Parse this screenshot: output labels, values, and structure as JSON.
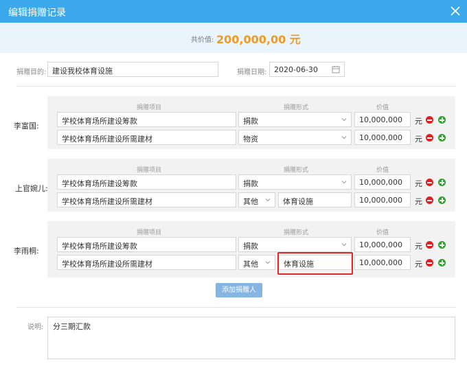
{
  "dialog": {
    "title": "编辑捐赠记录",
    "close_icon": "close-icon"
  },
  "summary": {
    "label": "共价值:",
    "value": "200,000,00 元"
  },
  "form": {
    "purpose_label": "捐赠目的:",
    "purpose_value": "建设我校体育设施",
    "date_label": "捐赠日期:",
    "date_value": "2020-06-30"
  },
  "columns": {
    "item": "捐赠项目",
    "form": "捐赠形式",
    "value": "价值"
  },
  "donors": [
    {
      "name": "李富国:",
      "rows": [
        {
          "item": "学校体育场所建设筹款",
          "form": "捐款",
          "extra": "",
          "value": "10,000,000",
          "unit": "元"
        },
        {
          "item": "学校体育场所建设所需建材",
          "form": "物资",
          "extra": "",
          "value": "10,000,000",
          "unit": "元"
        }
      ]
    },
    {
      "name": "上官婉儿:",
      "rows": [
        {
          "item": "学校体育场所建设筹款",
          "form": "捐款",
          "extra": "",
          "value": "10,000,000",
          "unit": "元"
        },
        {
          "item": "学校体育场所建设所需建材",
          "form": "其他",
          "extra": "体育设施",
          "value": "10,000,000",
          "unit": "元"
        }
      ]
    },
    {
      "name": "李雨桐:",
      "rows": [
        {
          "item": "学校体育场所建设筹款",
          "form": "捐款",
          "extra": "",
          "value": "10,000,000",
          "unit": "元"
        },
        {
          "item": "学校体育场所建设所需建材",
          "form": "其他",
          "extra": "体育设施",
          "value": "10,000,000",
          "unit": "元"
        }
      ]
    }
  ],
  "add_donor_label": "添加捐赠人",
  "notes": {
    "label": "说明:",
    "value": "分三期汇款"
  },
  "colors": {
    "header": "#3aa8ea",
    "summary_bg": "#eaf4fc",
    "amount": "#f39a1e",
    "delete": "#e02020",
    "add": "#2fa52f",
    "highlight": "#e02a2a"
  }
}
